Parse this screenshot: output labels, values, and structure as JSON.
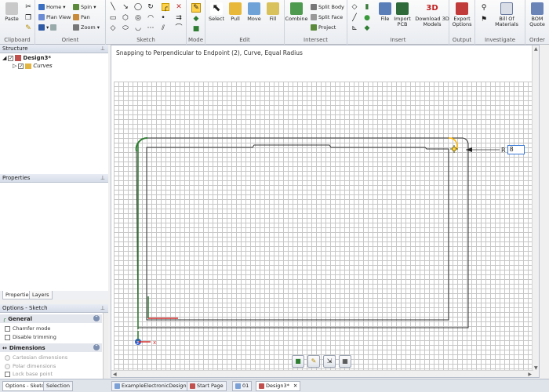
{
  "ribbon": {
    "clipboard": {
      "group": "Clipboard",
      "paste": "Paste"
    },
    "orient": {
      "group": "Orient",
      "home": "Home",
      "plan_view": "Plan View",
      "spin": "Spin",
      "pan": "Pan",
      "zoom": "Zoom"
    },
    "sketch": {
      "group": "Sketch"
    },
    "mode": {
      "group": "Mode"
    },
    "edit": {
      "group": "Edit",
      "select": "Select",
      "pull": "Pull",
      "move": "Move",
      "fill": "Fill"
    },
    "intersect": {
      "group": "Intersect",
      "combine": "Combine",
      "split_body": "Split Body",
      "split_face": "Split Face",
      "project": "Project"
    },
    "insert": {
      "group": "Insert",
      "file": "File",
      "import_pcb_1": "Import",
      "import_pcb_2": "PCB",
      "download_1": "Download 3D",
      "download_2": "Models"
    },
    "output": {
      "group": "Output",
      "export_1": "Export",
      "export_2": "Options"
    },
    "investigate": {
      "group": "Investigate",
      "bom_1": "Bill Of",
      "bom_2": "Materials"
    },
    "order": {
      "group": "Order",
      "bom_quote_1": "BOM",
      "bom_quote_2": "Quote"
    }
  },
  "structure": {
    "title": "Structure",
    "root": "Design3*",
    "child": "Curves"
  },
  "properties": {
    "title": "Properties"
  },
  "panel_tabs": [
    "Properties",
    "Layers"
  ],
  "options": {
    "title": "Options - Sketch",
    "general": "General",
    "chamfer_mode": "Chamfer mode",
    "disable_trimming": "Disable trimming",
    "dimensions": "Dimensions",
    "cartesian": "Cartesian dimensions",
    "polar": "Polar dimensions",
    "lock_base": "Lock base point"
  },
  "bottom_left_tabs": [
    "Options - Sketch",
    "Selection"
  ],
  "canvas": {
    "status": "Snapping to Perpendicular to Endpoint (2), Curve, Equal Radius",
    "radius_label": "R",
    "radius_value": "8",
    "axis_x": "x",
    "axis_z": "z"
  },
  "doc_tabs": [
    {
      "label": "ExampleElectronicDesign",
      "active": false
    },
    {
      "label": "Start Page",
      "active": false
    },
    {
      "label": "01",
      "active": false
    },
    {
      "label": "Design3*",
      "active": true
    }
  ],
  "colors": {
    "sketch_green": "#2e7d32",
    "sketch_dark": "#333333",
    "highlight_yellow": "#ffd24a"
  }
}
